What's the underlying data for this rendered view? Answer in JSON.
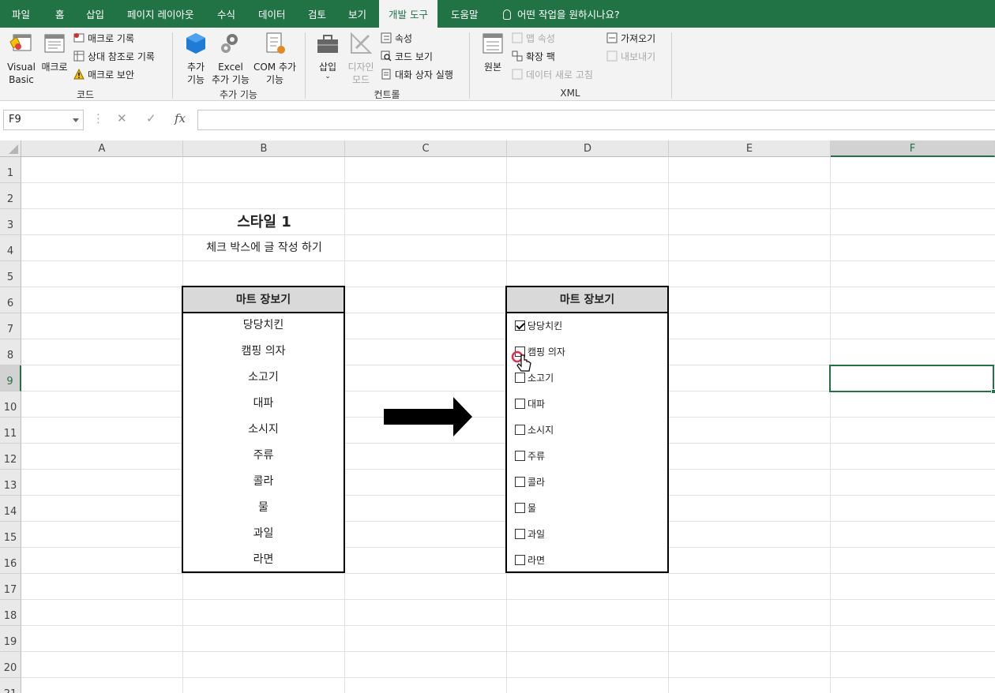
{
  "tabs": [
    "파일",
    "홈",
    "삽입",
    "페이지 레이아웃",
    "수식",
    "데이터",
    "검토",
    "보기",
    "개발 도구",
    "도움말"
  ],
  "active_tab": "개발 도구",
  "tell_me": "어떤 작업을 원하시나요?",
  "ribbon": {
    "code": {
      "label": "코드",
      "visual_basic": "Visual Basic",
      "macro": "매크로",
      "record_macro": "매크로 기록",
      "relative_ref": "상대 참조로 기록",
      "macro_security": "매크로 보안"
    },
    "addins": {
      "label": "추가 기능",
      "addins": "추가 기능",
      "excel_addins": "Excel 추가 기능",
      "com_addins": "COM 추가 기능"
    },
    "controls": {
      "label": "컨트롤",
      "insert": "삽입",
      "design_mode": "디자인 모드",
      "properties": "속성",
      "view_code": "코드 보기",
      "run_dialog": "대화 상자 실행"
    },
    "xml": {
      "label": "XML",
      "source": "원본",
      "map_properties": "맵 속성",
      "expansion_packs": "확장 팩",
      "refresh_data": "데이터 새로 고침",
      "import": "가져오기",
      "export": "내보내기"
    }
  },
  "formula_bar": {
    "name_box": "F9",
    "cancel": "✕",
    "enter": "✓",
    "fx": "fx",
    "value": ""
  },
  "columns": [
    "A",
    "B",
    "C",
    "D",
    "E",
    "F"
  ],
  "rows": [
    "1",
    "2",
    "3",
    "4",
    "5",
    "6",
    "7",
    "8",
    "9",
    "10",
    "11",
    "12",
    "13",
    "14",
    "15",
    "16",
    "17",
    "18",
    "19",
    "20",
    "21"
  ],
  "selected_cell": "F9",
  "sheet": {
    "title": "스타일 1",
    "subtitle": "체크 박스에 글 작성 하기",
    "left_table": {
      "header": "마트 장보기",
      "items": [
        "당당치킨",
        "캠핑 의자",
        "소고기",
        "대파",
        "소시지",
        "주류",
        "콜라",
        "물",
        "과일",
        "라면"
      ]
    },
    "right_table": {
      "header": "마트 장보기",
      "items": [
        {
          "label": "당당치킨",
          "checked": true
        },
        {
          "label": "캠핑 의자",
          "checked": false
        },
        {
          "label": "소고기",
          "checked": false
        },
        {
          "label": "대파",
          "checked": false
        },
        {
          "label": "소시지",
          "checked": false
        },
        {
          "label": "주류",
          "checked": false
        },
        {
          "label": "콜라",
          "checked": false
        },
        {
          "label": "물",
          "checked": false
        },
        {
          "label": "과일",
          "checked": false
        },
        {
          "label": "라면",
          "checked": false
        }
      ]
    }
  },
  "colors": {
    "accent": "#217346",
    "header_fill": "#d9d9d9"
  }
}
